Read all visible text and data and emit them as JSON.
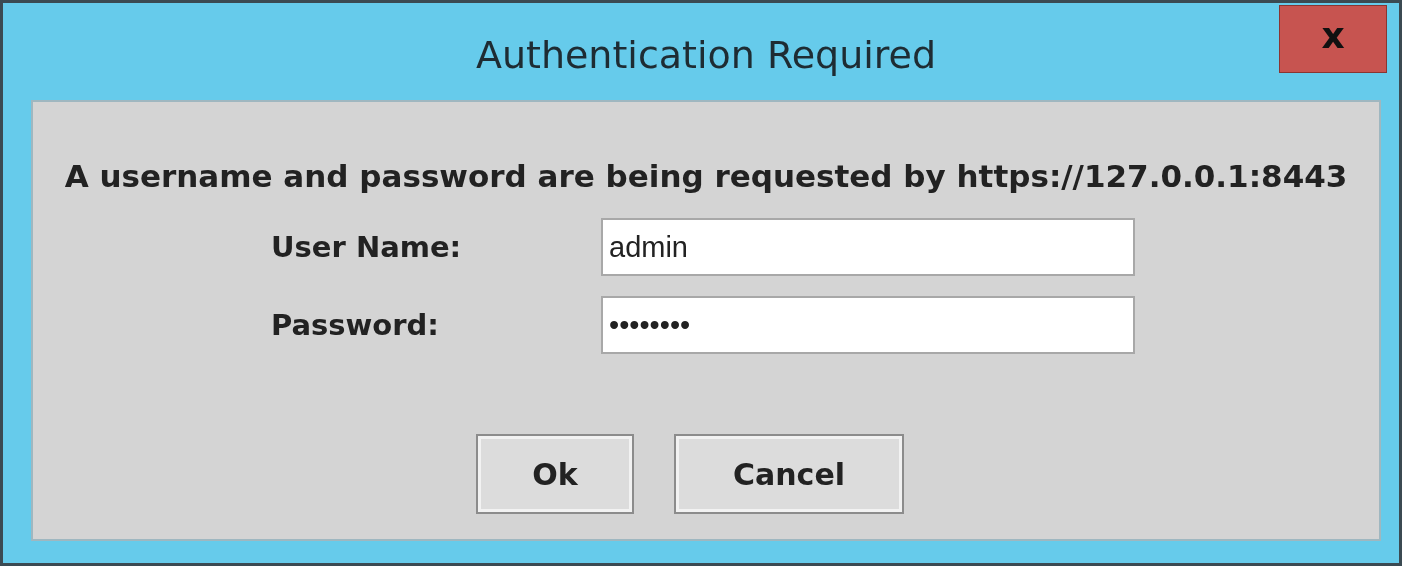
{
  "window": {
    "title": "Authentication Required",
    "close": "x"
  },
  "message": "A username and password are being requested by https://127.0.0.1:8443",
  "fields": [
    {
      "label": "User Name:",
      "value": "admin"
    },
    {
      "label": "Password:",
      "value": "••••••••"
    }
  ],
  "buttons": [
    "Ok",
    "Cancel"
  ]
}
